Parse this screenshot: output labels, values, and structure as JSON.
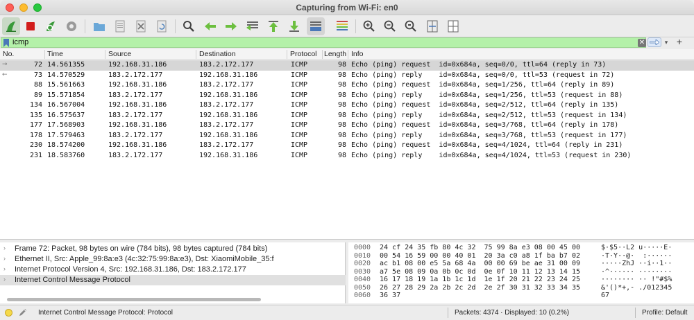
{
  "window": {
    "title": "Capturing from Wi-Fi: en0"
  },
  "toolbar": {
    "buttons": [
      "start-capture-icon",
      "stop-capture-icon",
      "restart-capture-icon",
      "capture-options-icon",
      "open-file-icon",
      "save-file-icon",
      "close-file-icon",
      "reload-file-icon",
      "find-packet-icon",
      "go-back-icon",
      "go-forward-icon",
      "go-to-packet-icon",
      "go-first-icon",
      "go-last-icon",
      "autoscroll-icon",
      "colorize-icon",
      "zoom-in-icon",
      "zoom-out-icon",
      "zoom-reset-icon",
      "resize-columns-icon",
      "layout-icon"
    ]
  },
  "filter": {
    "value": "icmp",
    "clear_symbol": "✕",
    "dropdown_symbol": "▾",
    "add_symbol": "+"
  },
  "columns": {
    "no": "No.",
    "time": "Time",
    "source": "Source",
    "destination": "Destination",
    "protocol": "Protocol",
    "length": "Length",
    "info": "Info"
  },
  "packets": [
    {
      "no": "72",
      "time": "14.561355",
      "src": "192.168.31.186",
      "dst": "183.2.172.177",
      "proto": "ICMP",
      "len": "98",
      "info": "Echo (ping) request  id=0x684a, seq=0/0, ttl=64 (reply in 73)",
      "selected": true,
      "arrow": "→"
    },
    {
      "no": "73",
      "time": "14.570529",
      "src": "183.2.172.177",
      "dst": "192.168.31.186",
      "proto": "ICMP",
      "len": "98",
      "info": "Echo (ping) reply    id=0x684a, seq=0/0, ttl=53 (request in 72)",
      "selected": false,
      "arrow": "←"
    },
    {
      "no": "88",
      "time": "15.561663",
      "src": "192.168.31.186",
      "dst": "183.2.172.177",
      "proto": "ICMP",
      "len": "98",
      "info": "Echo (ping) request  id=0x684a, seq=1/256, ttl=64 (reply in 89)",
      "selected": false,
      "arrow": ""
    },
    {
      "no": "89",
      "time": "15.571854",
      "src": "183.2.172.177",
      "dst": "192.168.31.186",
      "proto": "ICMP",
      "len": "98",
      "info": "Echo (ping) reply    id=0x684a, seq=1/256, ttl=53 (request in 88)",
      "selected": false,
      "arrow": ""
    },
    {
      "no": "134",
      "time": "16.567004",
      "src": "192.168.31.186",
      "dst": "183.2.172.177",
      "proto": "ICMP",
      "len": "98",
      "info": "Echo (ping) request  id=0x684a, seq=2/512, ttl=64 (reply in 135)",
      "selected": false,
      "arrow": ""
    },
    {
      "no": "135",
      "time": "16.575637",
      "src": "183.2.172.177",
      "dst": "192.168.31.186",
      "proto": "ICMP",
      "len": "98",
      "info": "Echo (ping) reply    id=0x684a, seq=2/512, ttl=53 (request in 134)",
      "selected": false,
      "arrow": ""
    },
    {
      "no": "177",
      "time": "17.568903",
      "src": "192.168.31.186",
      "dst": "183.2.172.177",
      "proto": "ICMP",
      "len": "98",
      "info": "Echo (ping) request  id=0x684a, seq=3/768, ttl=64 (reply in 178)",
      "selected": false,
      "arrow": ""
    },
    {
      "no": "178",
      "time": "17.579463",
      "src": "183.2.172.177",
      "dst": "192.168.31.186",
      "proto": "ICMP",
      "len": "98",
      "info": "Echo (ping) reply    id=0x684a, seq=3/768, ttl=53 (request in 177)",
      "selected": false,
      "arrow": ""
    },
    {
      "no": "230",
      "time": "18.574200",
      "src": "192.168.31.186",
      "dst": "183.2.172.177",
      "proto": "ICMP",
      "len": "98",
      "info": "Echo (ping) request  id=0x684a, seq=4/1024, ttl=64 (reply in 231)",
      "selected": false,
      "arrow": ""
    },
    {
      "no": "231",
      "time": "18.583760",
      "src": "183.2.172.177",
      "dst": "192.168.31.186",
      "proto": "ICMP",
      "len": "98",
      "info": "Echo (ping) reply    id=0x684a, seq=4/1024, ttl=53 (request in 230)",
      "selected": false,
      "arrow": ""
    }
  ],
  "details": [
    {
      "caret": "›",
      "text": "Frame 72: Packet, 98 bytes on wire (784 bits), 98 bytes captured (784 bits)",
      "selected": false
    },
    {
      "caret": "›",
      "text": "Ethernet II, Src: Apple_99:8a:e3 (4c:32:75:99:8a:e3), Dst: XiaomiMobile_35:f",
      "selected": false
    },
    {
      "caret": "›",
      "text": "Internet Protocol Version 4, Src: 192.168.31.186, Dst: 183.2.172.177",
      "selected": false
    },
    {
      "caret": "›",
      "text": "Internet Control Message Protocol",
      "selected": true
    }
  ],
  "bytes": {
    "offsets": [
      "0000",
      "0010",
      "0020",
      "0030",
      "0040",
      "0050",
      "0060"
    ],
    "hex": [
      "24 cf 24 35 fb 80 4c 32  75 99 8a e3 08 00 45 00",
      "00 54 16 59 00 00 40 01  20 3a c0 a8 1f ba b7 02",
      "ac b1 08 00 e5 5a 68 4a  00 00 69 be ae 31 00 09",
      "a7 5e 08 09 0a 0b 0c 0d  0e 0f 10 11 12 13 14 15",
      "16 17 18 19 1a 1b 1c 1d  1e 1f 20 21 22 23 24 25",
      "26 27 28 29 2a 2b 2c 2d  2e 2f 30 31 32 33 34 35",
      "36 37"
    ],
    "ascii": [
      "$·$5··L2 u·····E·",
      "·T·Y··@·  :······",
      "·····ZhJ ··i··1··",
      "·^······ ········",
      "········ ·· !\"#$%",
      "&'()*+,- ./012345",
      "67"
    ]
  },
  "status": {
    "message": "Internet Control Message Protocol: Protocol",
    "packets": "Packets: 4374 · Displayed: 10 (0.2%)",
    "profile": "Profile: Default"
  }
}
